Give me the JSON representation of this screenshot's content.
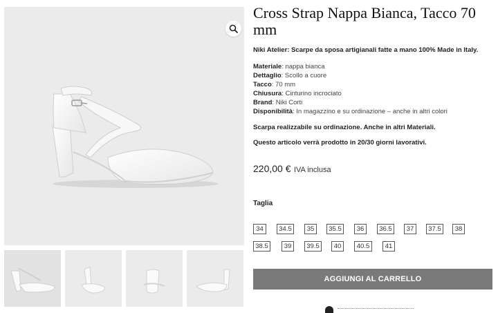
{
  "product": {
    "title": "Cross Strap Nappa Bianca, Tacco 70 mm",
    "intro": "Niki Atelier: Scarpe da sposa artigianali fatte a mano 100% Made in Italy.",
    "specs": [
      {
        "label": "Materiale",
        "value": ": nappa bianca"
      },
      {
        "label": "Dettaglio",
        "value": ": Scollo a cuore"
      },
      {
        "label": "Tacco",
        "value": ": 70 mm"
      },
      {
        "label": "Chiusura",
        "value": ": Cinturino incrociato"
      },
      {
        "label": "Brand",
        "value": ": Niki Corti"
      },
      {
        "label": "Disponibilità",
        "value": ": In magazzino e su ordinazione – anche in altri colori"
      }
    ],
    "note_order": "Scarpa realizzabile su ordinazione. Anche in altri Materiali.",
    "note_production": "Questo articolo verrà prodotto in 20/30 giorni lavorativi.",
    "price": "220,00 €",
    "tax_label": "IVA inclusa",
    "size_label": "Taglia",
    "sizes": [
      "34",
      "34.5",
      "35",
      "35.5",
      "36",
      "36.5",
      "37",
      "37.5",
      "38",
      "38.5",
      "39",
      "39.5",
      "40",
      "40.5",
      "41"
    ],
    "add_to_cart": "AGGIUNGI AL CARRELLO"
  },
  "gallery": {
    "thumbnail_count": 4,
    "zoom_icon": "magnifier-icon"
  },
  "colors": {
    "button_bg": "#7a7a7a",
    "image_bg": "#ebebeb"
  }
}
